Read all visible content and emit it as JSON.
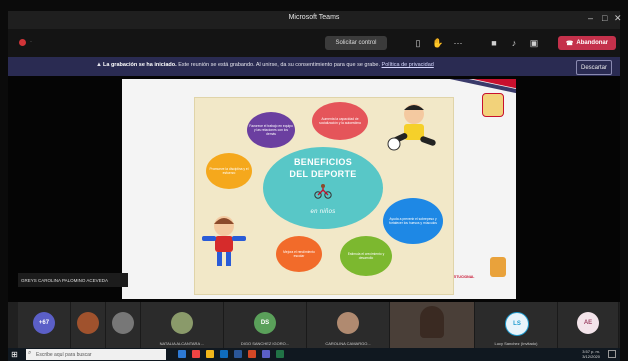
{
  "window": {
    "title": "Microsoft Teams",
    "minimize": "–",
    "maximize": "□",
    "close": "✕"
  },
  "toolbar": {
    "timer": "·",
    "request_control": "Solicitar control",
    "leave": "Abandonar"
  },
  "banner": {
    "lead": "La grabación se ha iniciado.",
    "text": " Este reunión se está grabando. Al unirse, da su consentimiento para que se grabe.",
    "link": "Política de privacidad",
    "dismiss": "Descartar"
  },
  "slide": {
    "title_line1": "BENEFICIOS",
    "title_line2": "DEL DEPORTE",
    "subtitle": "en niños",
    "presenter": "GREYS CAROLINA PALOMINO ACEVEDA",
    "logo_org": "ASOCIACIÓN INSTITUCIONAL",
    "bubbles": [
      "Aumenta la capacidad de socialización y la autoestima",
      "Favorece el trabajo en equipo y las relaciones con los demás",
      "Promueve la disciplina y el esfuerzo",
      "Mejora la coordinación y el equilibrio",
      "Ayuda a prevenir el sobrepeso y fortalecer los huesos y músculos",
      "Mejora el rendimiento escolar",
      "Estimula el crecimiento y desarrollo"
    ]
  },
  "participants": [
    {
      "initials": "+67",
      "name": "",
      "color": "#5b5fc7"
    },
    {
      "initials": "",
      "name": "",
      "color": "#a0522d"
    },
    {
      "initials": "",
      "name": "",
      "color": "#777777"
    },
    {
      "initials": "",
      "name": "NATALIA ALCANTARA ...",
      "color": "#8a9a6a"
    },
    {
      "initials": "DS",
      "name": "DIGO SANCHEZ IGORO...",
      "color": "#5aa05a"
    },
    {
      "initials": "",
      "name": "CAROLINA CAMARGO...",
      "color": "#b08a70"
    },
    {
      "initials": "",
      "name": "",
      "color": "#6a5a50"
    },
    {
      "initials": "LS",
      "name": "Lucy Sanchez (Invitado)",
      "color": "#1f9bcf"
    },
    {
      "initials": "AE",
      "name": "",
      "color": "#c7a0b0"
    }
  ],
  "taskbar": {
    "search_placeholder": "Escribe aquí para buscar",
    "time": "3:57 p. m.",
    "date": "3/12/2020"
  }
}
